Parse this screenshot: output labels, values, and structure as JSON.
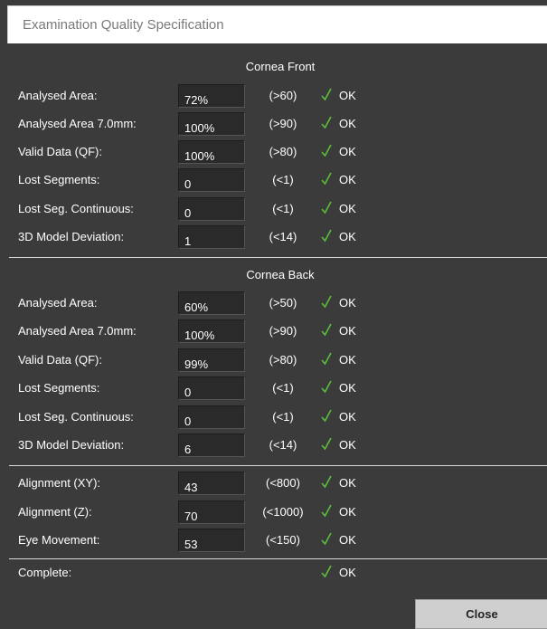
{
  "window": {
    "title": "Examination Quality Specification"
  },
  "colors": {
    "background": "#3b3b3b",
    "check": "#5bbf3a",
    "field": "#2a2a2a"
  },
  "icons": {
    "status": "checkmark-icon"
  },
  "cornea_front": {
    "title": "Cornea Front",
    "rows": [
      {
        "label": "Analysed Area:",
        "value": "72%",
        "range": "(>60)",
        "status": "OK"
      },
      {
        "label": "Analysed Area 7.0mm:",
        "value": "100%",
        "range": "(>90)",
        "status": "OK"
      },
      {
        "label": "Valid Data (QF):",
        "value": "100%",
        "range": "(>80)",
        "status": "OK"
      },
      {
        "label": "Lost Segments:",
        "value": "0",
        "range": "(<1)",
        "status": "OK"
      },
      {
        "label": "Lost Seg. Continuous:",
        "value": "0",
        "range": "(<1)",
        "status": "OK"
      },
      {
        "label": "3D Model Deviation:",
        "value": "1",
        "range": "(<14)",
        "status": "OK"
      }
    ]
  },
  "cornea_back": {
    "title": "Cornea Back",
    "rows": [
      {
        "label": "Analysed Area:",
        "value": "60%",
        "range": "(>50)",
        "status": "OK"
      },
      {
        "label": "Analysed Area 7.0mm:",
        "value": "100%",
        "range": "(>90)",
        "status": "OK"
      },
      {
        "label": "Valid Data (QF):",
        "value": "99%",
        "range": "(>80)",
        "status": "OK"
      },
      {
        "label": "Lost Segments:",
        "value": "0",
        "range": "(<1)",
        "status": "OK"
      },
      {
        "label": "Lost Seg. Continuous:",
        "value": "0",
        "range": "(<1)",
        "status": "OK"
      },
      {
        "label": "3D Model Deviation:",
        "value": "6",
        "range": "(<14)",
        "status": "OK"
      }
    ]
  },
  "alignment": {
    "rows": [
      {
        "label": "Alignment (XY):",
        "value": "43",
        "range": "(<800)",
        "status": "OK"
      },
      {
        "label": "Alignment (Z):",
        "value": "70",
        "range": "(<1000)",
        "status": "OK"
      },
      {
        "label": "Eye Movement:",
        "value": "53",
        "range": "(<150)",
        "status": "OK"
      }
    ]
  },
  "complete": {
    "label": "Complete:",
    "status": "OK"
  },
  "buttons": {
    "close": "Close"
  }
}
